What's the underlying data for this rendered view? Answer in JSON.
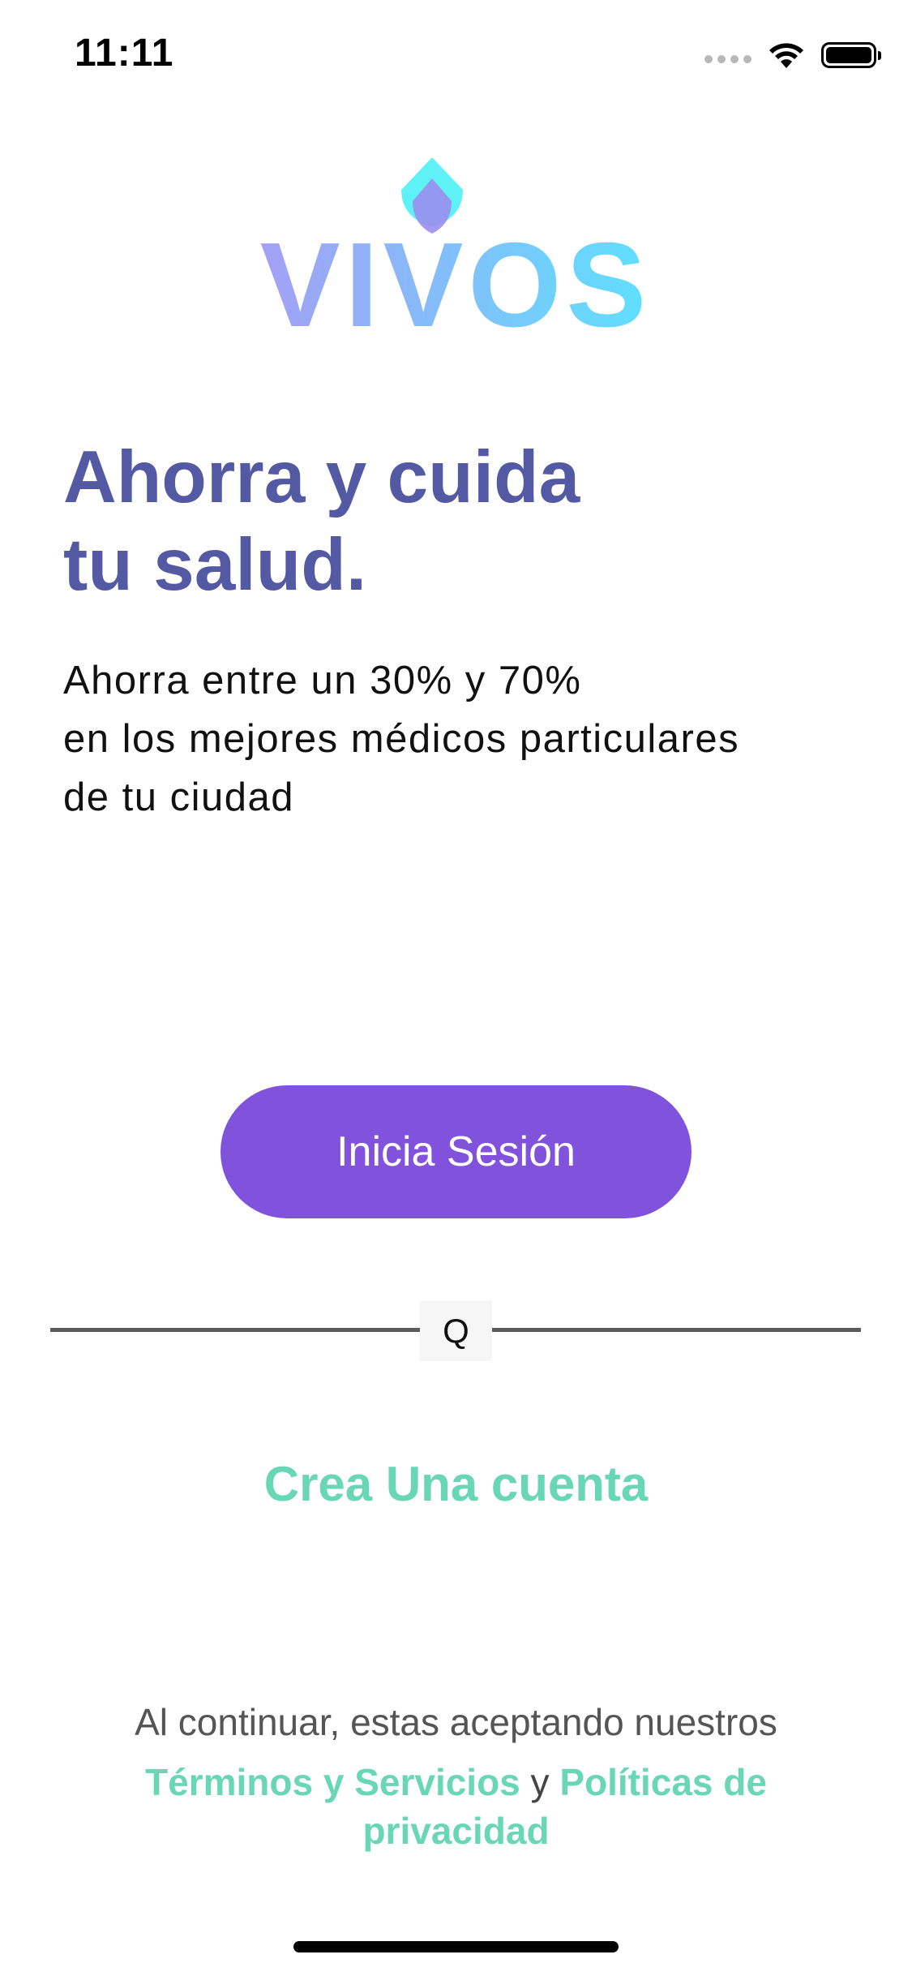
{
  "status_bar": {
    "time": "11:11"
  },
  "logo": {
    "text": "VIVOS",
    "gradient_start": "#a3a0f5",
    "gradient_end": "#5fe0ff",
    "drop_outer_color": "#5ef2f7",
    "drop_inner_color": "#9b8ef0"
  },
  "hero": {
    "headline_line1": "Ahorra y cuida",
    "headline_line2": "tu salud.",
    "sub_line1": "Ahorra entre un 30% y 70%",
    "sub_line2": "en los mejores médicos particulares",
    "sub_line3": "de tu ciudad"
  },
  "actions": {
    "login_label": "Inicia Sesión",
    "divider_label": "Q",
    "create_account_label": "Crea Una cuenta"
  },
  "legal": {
    "intro": "Al continuar, estas aceptando nuestros",
    "terms_link": "Términos y Servicios",
    "conjunction": "y",
    "privacy_link": "Políticas de privacidad"
  },
  "colors": {
    "headline": "#5459a3",
    "primary_button": "#8153dd",
    "accent_green": "#69d6b5"
  }
}
